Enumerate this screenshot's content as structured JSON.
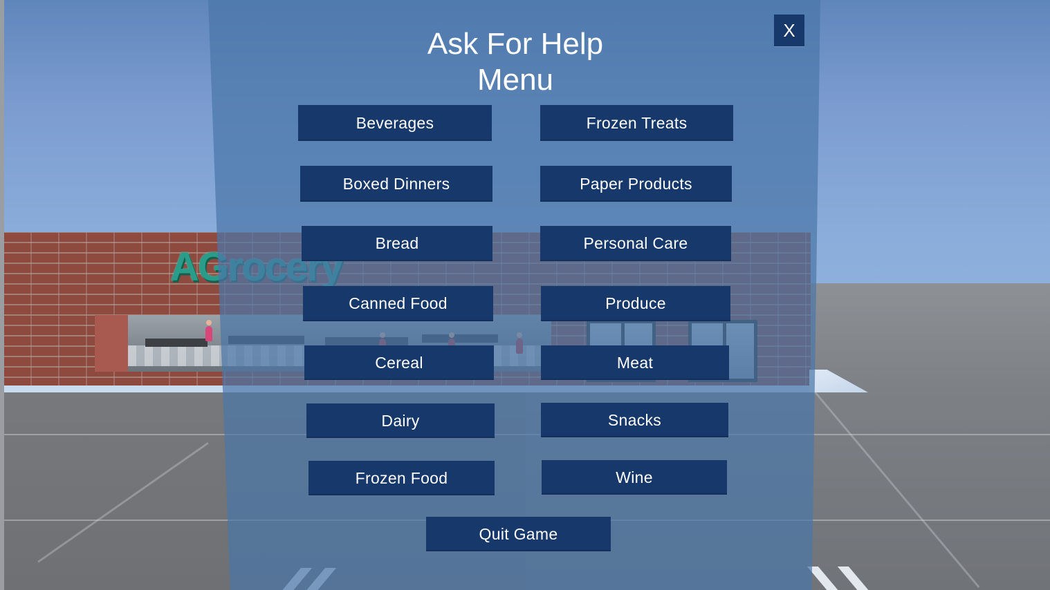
{
  "menu": {
    "title_line1": "Ask For Help",
    "title_line2": "Menu",
    "close_label": "X",
    "categories": [
      "Beverages",
      "Frozen Treats",
      "Boxed Dinners",
      "Paper Products",
      "Bread",
      "Personal Care",
      "Canned Food",
      "Produce",
      "Cereal",
      "Meat",
      "Dairy",
      "Snacks",
      "Frozen Food",
      "Wine"
    ],
    "quit_label": "Quit Game"
  },
  "scene": {
    "store_sign": "AGrocery"
  },
  "colors": {
    "button": "#17386a",
    "panel": "#4a76a8",
    "text": "#ffffff",
    "logo": "#2a9c8a"
  }
}
